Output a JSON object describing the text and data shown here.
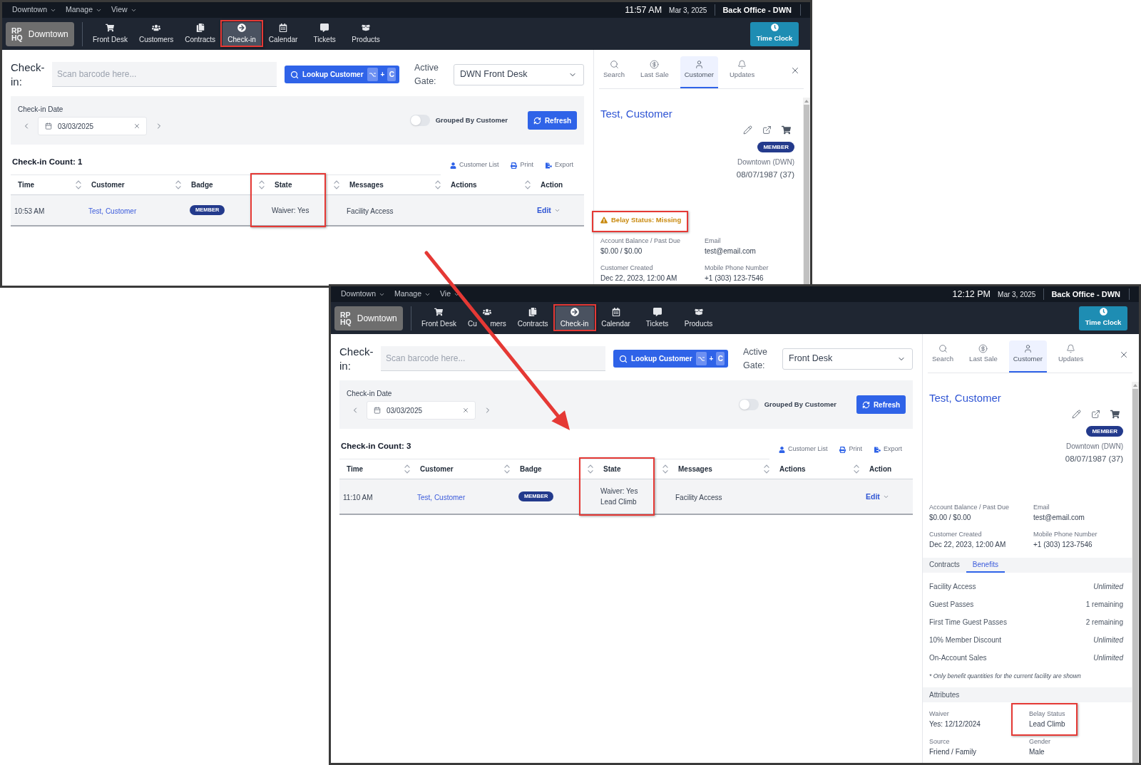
{
  "windows": [
    {
      "top_menu": [
        {
          "label": "Downtown"
        },
        {
          "label": "Manage"
        },
        {
          "label": "View"
        }
      ],
      "clock": {
        "time": "11:57 AM",
        "date": "Mar 3, 2025"
      },
      "workstation": "Back Office - DWN",
      "logo": {
        "lines": [
          "RP",
          "HQ"
        ],
        "location": "Downtown"
      },
      "nav_items": [
        {
          "label": "Front Desk",
          "selected": false,
          "highlighted": false
        },
        {
          "label": "Customers",
          "selected": false,
          "highlighted": false
        },
        {
          "label": "Contracts",
          "selected": false,
          "highlighted": false
        },
        {
          "label": "Check-in",
          "selected": true,
          "highlighted": true
        },
        {
          "label": "Calendar",
          "selected": false,
          "highlighted": false
        },
        {
          "label": "Tickets",
          "selected": false,
          "highlighted": false
        },
        {
          "label": "Products",
          "selected": false,
          "highlighted": false
        }
      ],
      "time_clock_button": "Time Clock",
      "check_in": {
        "heading": "Check-in:",
        "barcode_placeholder": "Scan barcode here...",
        "lookup_button": {
          "label": "Lookup Customer",
          "joiner": "+",
          "key": "C"
        },
        "gate_label": "Active Gate:",
        "gate_value": "DWN Front Desk",
        "date_label": "Check-in Date",
        "date_value": "03/03/2025",
        "grouped_toggle": {
          "label": "Grouped By Customer",
          "on": false
        },
        "refresh_button": "Refresh",
        "count_title": "Check-in Count: 1",
        "toolbar": [
          "Customer List",
          "Print",
          "Export"
        ],
        "table": {
          "columns": [
            {
              "label": "Time",
              "sortable": true,
              "highlighted": false
            },
            {
              "label": "Customer",
              "sortable": true,
              "highlighted": false
            },
            {
              "label": "Badge",
              "sortable": true,
              "highlighted": false
            },
            {
              "label": "State",
              "sortable": true,
              "highlighted": true
            },
            {
              "label": "Messages",
              "sortable": true,
              "highlighted": false
            },
            {
              "label": "Actions",
              "sortable": true,
              "highlighted": false
            },
            {
              "label": "Action",
              "sortable": false,
              "highlighted": false
            }
          ],
          "rows": [
            {
              "time": "10:53 AM",
              "customer": "Test, Customer",
              "badge": "MEMBER",
              "state": [
                "Waiver: Yes"
              ],
              "messages": "Facility Access",
              "action": "Edit"
            }
          ]
        }
      },
      "customer_panel": {
        "tabs": [
          {
            "label": "Search",
            "selected": false
          },
          {
            "label": "Last Sale",
            "selected": false
          },
          {
            "label": "Customer",
            "selected": true
          },
          {
            "label": "Updates",
            "selected": false
          }
        ],
        "name": "Test, Customer",
        "badge": "MEMBER",
        "home_location": "Downtown (DWN)",
        "birth_date": "08/07/1987 (37)",
        "belay_warning": {
          "text": "Belay Status: Missing",
          "highlighted": true
        },
        "details": [
          {
            "label": "Account Balance / Past Due",
            "value": "$0.00 / $0.00"
          },
          {
            "label": "Email",
            "value": "test@email.com"
          },
          {
            "label": "Customer Created",
            "value": "Dec 22, 2023, 12:00 AM"
          },
          {
            "label": "Mobile Phone Number",
            "value": "+1 (303) 123-7546"
          }
        ]
      }
    },
    {
      "top_menu": [
        {
          "label": "Downtown"
        },
        {
          "label": "Manage"
        },
        {
          "label": "Vie"
        }
      ],
      "clock": {
        "time": "12:12 PM",
        "date": "Mar 3, 2025"
      },
      "workstation": "Back Office - DWN",
      "logo": {
        "lines": [
          "RP",
          "HQ"
        ],
        "location": "Downtown"
      },
      "nav_items": [
        {
          "label": "Front Desk",
          "selected": false,
          "highlighted": false
        },
        {
          "label_parts": [
            "Cu",
            "mers"
          ],
          "selected": false,
          "highlighted": false
        },
        {
          "label": "Contracts",
          "selected": false,
          "highlighted": false
        },
        {
          "label": "Check-in",
          "selected": true,
          "highlighted": true
        },
        {
          "label": "Calendar",
          "selected": false,
          "highlighted": false
        },
        {
          "label": "Tickets",
          "selected": false,
          "highlighted": false
        },
        {
          "label": "Products",
          "selected": false,
          "highlighted": false
        }
      ],
      "time_clock_button": "Time Clock",
      "check_in": {
        "heading": "Check-in:",
        "barcode_placeholder": "Scan barcode here...",
        "lookup_button": {
          "label": "Lookup Customer",
          "joiner": "+",
          "key": "C"
        },
        "gate_label": "Active Gate:",
        "gate_value": "Front Desk",
        "date_label": "Check-in Date",
        "date_value": "03/03/2025",
        "grouped_toggle": {
          "label": "Grouped By Customer",
          "on": false
        },
        "refresh_button": "Refresh",
        "count_title": "Check-in Count: 3",
        "toolbar": [
          "Customer List",
          "Print",
          "Export"
        ],
        "table": {
          "columns": [
            {
              "label": "Time",
              "sortable": true,
              "highlighted": false
            },
            {
              "label": "Customer",
              "sortable": true,
              "highlighted": false
            },
            {
              "label": "Badge",
              "sortable": true,
              "highlighted": false
            },
            {
              "label": "State",
              "sortable": true,
              "highlighted": true
            },
            {
              "label": "Messages",
              "sortable": true,
              "highlighted": false
            },
            {
              "label": "Actions",
              "sortable": true,
              "highlighted": false
            },
            {
              "label": "Action",
              "sortable": false,
              "highlighted": false
            }
          ],
          "rows": [
            {
              "time": "11:10 AM",
              "customer": "Test, Customer",
              "badge": "MEMBER",
              "state": [
                "Waiver: Yes",
                "Lead Climb"
              ],
              "messages": "Facility Access",
              "action": "Edit"
            }
          ]
        }
      },
      "customer_panel": {
        "tabs": [
          {
            "label": "Search",
            "selected": false
          },
          {
            "label": "Last Sale",
            "selected": false
          },
          {
            "label": "Customer",
            "selected": true
          },
          {
            "label": "Updates",
            "selected": false
          }
        ],
        "name": "Test, Customer",
        "badge": "MEMBER",
        "home_location": "Downtown (DWN)",
        "birth_date": "08/07/1987 (37)",
        "details": [
          {
            "label": "Account Balance / Past Due",
            "value": "$0.00 / $0.00"
          },
          {
            "label": "Email",
            "value": "test@email.com"
          },
          {
            "label": "Customer Created",
            "value": "Dec 22, 2023, 12:00 AM"
          },
          {
            "label": "Mobile Phone Number",
            "value": "+1 (303) 123-7546"
          }
        ],
        "section_tabs": [
          {
            "label": "Contracts",
            "selected": false
          },
          {
            "label": "Benefits",
            "selected": true
          }
        ],
        "benefits": [
          {
            "name": "Facility Access",
            "quantity": "Unlimited",
            "kind": "unlimited"
          },
          {
            "name": "Guest Passes",
            "quantity": "1 remaining",
            "kind": "count"
          },
          {
            "name": "First Time Guest Passes",
            "quantity": "2 remaining",
            "kind": "count"
          },
          {
            "name": "10% Member Discount",
            "quantity": "Unlimited",
            "kind": "unlimited"
          },
          {
            "name": "On-Account Sales",
            "quantity": "Unlimited",
            "kind": "unlimited"
          }
        ],
        "benefits_note": "* Only benefit quantities for the current facility are shown",
        "attributes_title": "Attributes",
        "attributes": [
          {
            "label": "Waiver",
            "value": "Yes: 12/12/2024",
            "highlighted": false
          },
          {
            "label": "Belay Status",
            "value": "Lead Climb",
            "highlighted": true
          },
          {
            "label": "Source",
            "value": "Friend / Family",
            "highlighted": false
          },
          {
            "label": "Gender",
            "value": "Male",
            "highlighted": false
          }
        ]
      }
    }
  ]
}
